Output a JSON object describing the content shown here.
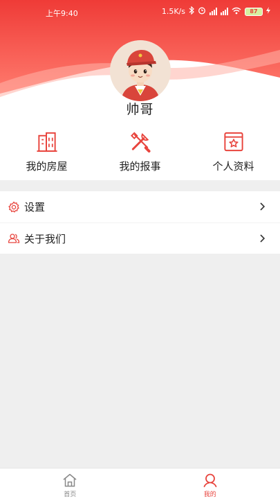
{
  "status_bar": {
    "time": "上午9:40",
    "network_speed": "1.5K/s",
    "battery": "87"
  },
  "profile": {
    "username": "帅哥",
    "avatar": "avatar-cartoon-boy"
  },
  "quick_actions": [
    {
      "label": "我的房屋",
      "icon": "building-icon"
    },
    {
      "label": "我的报事",
      "icon": "tools-icon"
    },
    {
      "label": "个人资料",
      "icon": "profile-card-icon"
    }
  ],
  "menu": [
    {
      "label": "设置",
      "icon": "gear-icon"
    },
    {
      "label": "关于我们",
      "icon": "users-icon"
    }
  ],
  "tabbar": [
    {
      "label": "首页",
      "icon": "home-icon",
      "active": false
    },
    {
      "label": "我的",
      "icon": "user-icon",
      "active": true
    }
  ],
  "colors": {
    "accent": "#e8443d",
    "header_gradient_top": "#ef3f3a",
    "header_gradient_bottom": "#ff8a7a",
    "page_background": "#efefef"
  }
}
